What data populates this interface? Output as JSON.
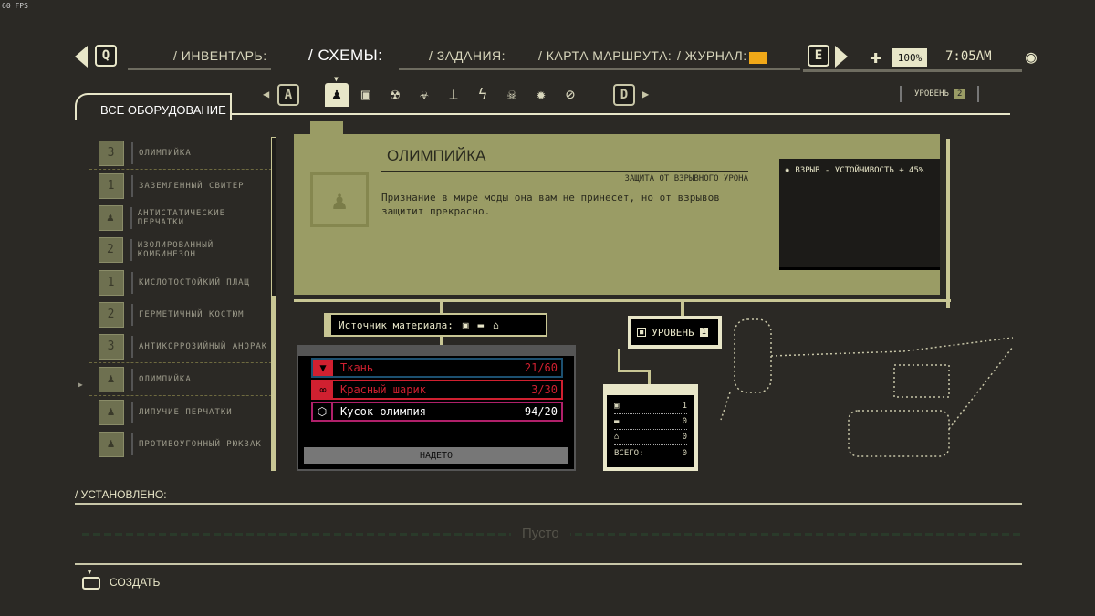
{
  "fps": "60 FPS",
  "nav": {
    "prev_key": "Q",
    "next_key": "E",
    "tabs": [
      {
        "label": "/ ИНВЕНТАРЬ:"
      },
      {
        "label": "/ СХЕМЫ:",
        "active": true
      },
      {
        "label": "/ ЗАДАНИЯ:"
      },
      {
        "label": "/ КАРТА МАРШРУТА:"
      },
      {
        "label": "/ ЖУРНАЛ:"
      }
    ],
    "mail_icon": "envelope-icon",
    "mail_color": "#f0a818"
  },
  "status": {
    "health": "100%",
    "time": "7:05AM"
  },
  "categories": {
    "prev_key": "A",
    "next_key": "D",
    "icons": [
      "suit-icon",
      "backpack-icon",
      "radiation-icon",
      "biohazard-icon",
      "pressure-icon",
      "electric-icon",
      "toxic-icon",
      "explosion-icon",
      "none-icon"
    ],
    "selected": 0
  },
  "level": {
    "label": "УРОВЕНЬ",
    "value": "2"
  },
  "sidebar": {
    "title": "ВСЕ ОБОРУДОВАНИЕ",
    "items": [
      {
        "label": "ОЛИМПИЙКА",
        "tier": "3"
      },
      {
        "label": "ЗАЗЕМЛЕННЫЙ СВИТЕР",
        "tier": "1"
      },
      {
        "label": "АНТИСТАТИЧЕСКИЕ ПЕРЧАТКИ"
      },
      {
        "label": "ИЗОЛИРОВАННЫЙ КОМБИНЕЗОН",
        "tier": "2"
      },
      {
        "label": "КИСЛОТОСТОЙКИЙ ПЛАЩ",
        "tier": "1"
      },
      {
        "label": "ГЕРМЕТИЧНЫЙ КОСТЮМ",
        "tier": "2"
      },
      {
        "label": "АНТИКОРРОЗИЙНЫЙ АНОРАК",
        "tier": "3"
      },
      {
        "label": "ОЛИМПИЙКА",
        "selected": true
      },
      {
        "label": "ЛИПУЧИЕ ПЕРЧАТКИ"
      },
      {
        "label": "ПРОТИВОУГОННЫЙ РЮКЗАК"
      }
    ]
  },
  "detail": {
    "title": "ОЛИМПИЙКА",
    "subtitle": "ЗАЩИТА ОТ ВЗРЫВНОГО УРОНА",
    "description": "Признание в мире моды она вам не принесет, но от взрывов защитит прекрасно.",
    "stat": "ВЗРЫВ - УСТОЙЧИВОСТЬ + 45%"
  },
  "source": {
    "label": "Источник материала:"
  },
  "materials": [
    {
      "name": "Ткань",
      "count": "21/60",
      "color": "#d02030"
    },
    {
      "name": "Красный шарик",
      "count": "3/30",
      "color": "#d02030"
    },
    {
      "name": "Кусок олимпия",
      "count": "94/20",
      "color": "#ffffff"
    }
  ],
  "equipped_label": "НАДЕТО",
  "upgrade": {
    "label": "УРОВЕНЬ",
    "value": "1"
  },
  "counts": {
    "rows": [
      {
        "icon": "backpack-icon",
        "value": "1"
      },
      {
        "icon": "car-icon",
        "value": "0"
      },
      {
        "icon": "house-icon",
        "value": "0"
      }
    ],
    "total_label": "ВСЕГО:",
    "total": "0"
  },
  "installed": {
    "label": "/ УСТАНОВЛЕНО:",
    "empty": "Пусто"
  },
  "footer": {
    "create": "СОЗДАТЬ"
  }
}
